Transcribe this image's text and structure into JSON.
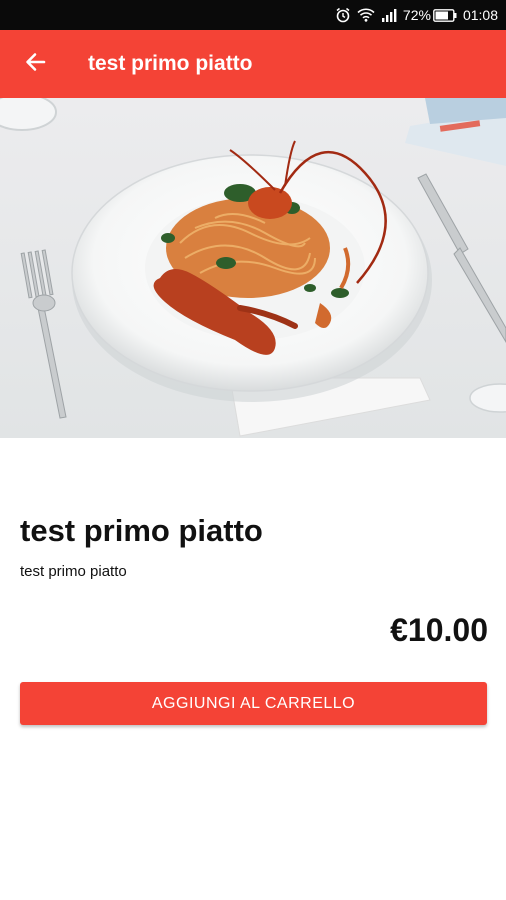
{
  "status_bar": {
    "battery_percent": "72%",
    "time": "01:08",
    "icons": [
      "alarm-icon",
      "wifi-icon",
      "signal-icon",
      "battery-icon"
    ]
  },
  "app_bar": {
    "back_icon": "arrow-left-icon",
    "title": "test primo piatto"
  },
  "product": {
    "image": "lobster spaghetti plate",
    "title": "test primo piatto",
    "description": "test primo piatto",
    "price": "€10.00",
    "add_to_cart_label": "AGGIUNGI AL CARRELLO"
  },
  "colors": {
    "accent": "#f44336",
    "status_bar": "#0a0a0a"
  }
}
